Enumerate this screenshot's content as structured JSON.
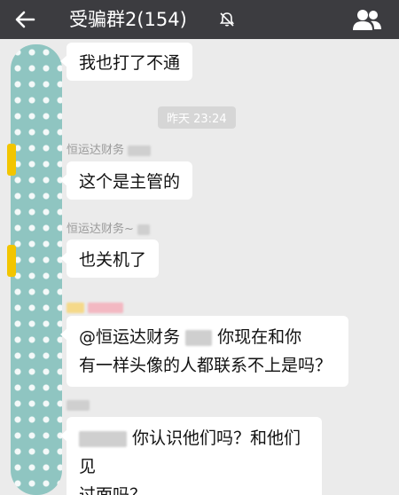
{
  "header": {
    "title": "受骗群2(154)",
    "back_icon": "back-arrow-icon",
    "mute_icon": "bell-muted-icon",
    "members_icon": "group-members-icon"
  },
  "messages": [
    {
      "text": "我也打了不通"
    },
    {
      "timestamp": "昨天 23:24"
    },
    {
      "sender": "恒运达财务",
      "text": "这个是主管的"
    },
    {
      "sender": "恒运达财务~",
      "text": "也关机了"
    },
    {
      "line1_prefix": "@恒运达财务",
      "line1_suffix": "你现在和你",
      "line2": "有一样头像的人都联系不上是吗？"
    },
    {
      "line1": "你认识他们吗？和他们见",
      "line2": "过面吗？"
    }
  ]
}
